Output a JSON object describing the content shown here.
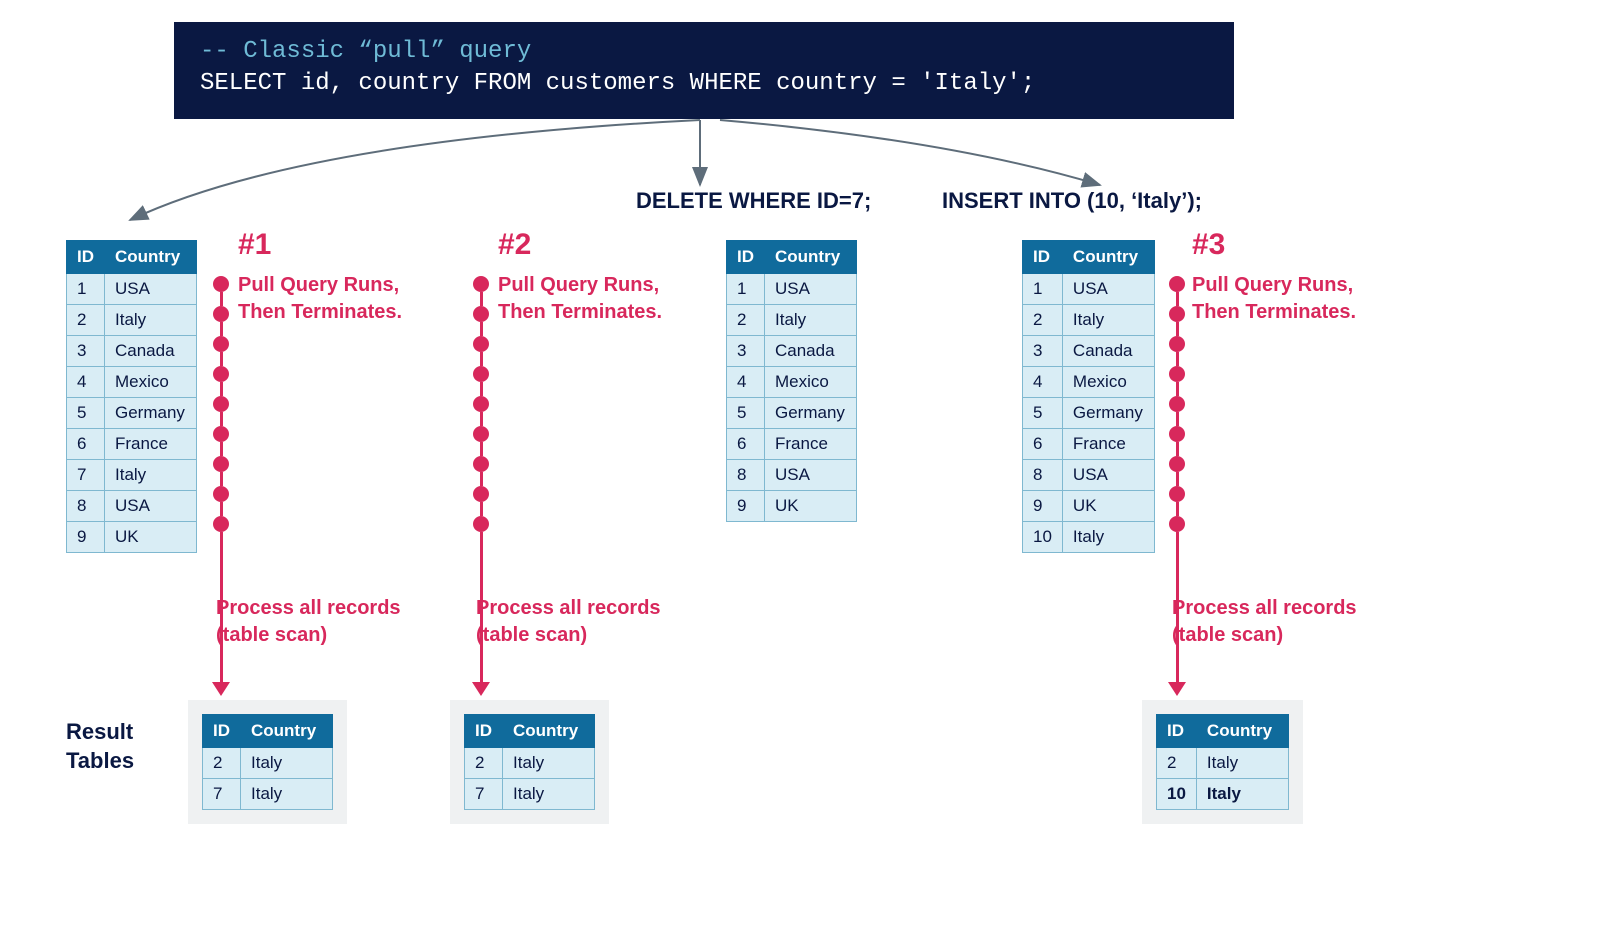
{
  "code": {
    "comment": "-- Classic “pull” query",
    "query": "SELECT id, country FROM customers WHERE country = 'Italy';"
  },
  "operations": {
    "delete": "DELETE WHERE ID=7;",
    "insert": "INSERT INTO (10, ‘Italy’);"
  },
  "steps": {
    "s1": {
      "num": "#1",
      "desc1": "Pull Query Runs,",
      "desc2": "Then Terminates."
    },
    "s2": {
      "num": "#2",
      "desc1": "Pull Query Runs,",
      "desc2": "Then Terminates."
    },
    "s3": {
      "num": "#3",
      "desc1": "Pull Query Runs,",
      "desc2": "Then Terminates."
    }
  },
  "process": {
    "line1": "Process all records",
    "line2": "(table scan)"
  },
  "resultLabel": {
    "line1": "Result",
    "line2": "Tables"
  },
  "headers": {
    "id": "ID",
    "country": "Country"
  },
  "tables": {
    "t1": [
      {
        "id": "1",
        "c": "USA"
      },
      {
        "id": "2",
        "c": "Italy"
      },
      {
        "id": "3",
        "c": "Canada"
      },
      {
        "id": "4",
        "c": "Mexico"
      },
      {
        "id": "5",
        "c": "Germany"
      },
      {
        "id": "6",
        "c": "France"
      },
      {
        "id": "7",
        "c": "Italy"
      },
      {
        "id": "8",
        "c": "USA"
      },
      {
        "id": "9",
        "c": "UK"
      }
    ],
    "t2": [
      {
        "id": "1",
        "c": "USA"
      },
      {
        "id": "2",
        "c": "Italy"
      },
      {
        "id": "3",
        "c": "Canada"
      },
      {
        "id": "4",
        "c": "Mexico"
      },
      {
        "id": "5",
        "c": "Germany"
      },
      {
        "id": "6",
        "c": "France"
      },
      {
        "id": "8",
        "c": "USA"
      },
      {
        "id": "9",
        "c": "UK"
      }
    ],
    "t3": [
      {
        "id": "1",
        "c": "USA"
      },
      {
        "id": "2",
        "c": "Italy"
      },
      {
        "id": "3",
        "c": "Canada"
      },
      {
        "id": "4",
        "c": "Mexico"
      },
      {
        "id": "5",
        "c": "Germany"
      },
      {
        "id": "6",
        "c": "France"
      },
      {
        "id": "8",
        "c": "USA"
      },
      {
        "id": "9",
        "c": "UK"
      },
      {
        "id": "10",
        "c": "Italy"
      }
    ],
    "r1": [
      {
        "id": "2",
        "c": "Italy"
      },
      {
        "id": "7",
        "c": "Italy"
      }
    ],
    "r2": [
      {
        "id": "2",
        "c": "Italy"
      },
      {
        "id": "7",
        "c": "Italy"
      }
    ],
    "r3": [
      {
        "id": "2",
        "c": "Italy"
      },
      {
        "id": "10",
        "c": "Italy",
        "bold": true
      }
    ]
  }
}
